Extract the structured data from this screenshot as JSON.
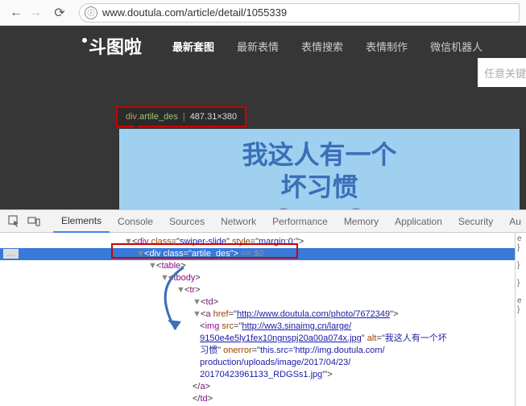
{
  "browser": {
    "url": "www.doutula.com/article/detail/1055339",
    "info_icon": "ⓘ"
  },
  "nav": {
    "logo": "斗图啦",
    "items": [
      "最新套图",
      "最新表情",
      "表情搜索",
      "表情制作",
      "微信机器人"
    ],
    "active_index": 0,
    "search_placeholder": "任意关键"
  },
  "tooltip": {
    "tag": "div",
    "cls": ".artile_des",
    "dim": "487.31×380"
  },
  "meme": {
    "line1": "我这人有一个",
    "line2": "坏习惯"
  },
  "devtools": {
    "tabs": [
      "Elements",
      "Console",
      "Sources",
      "Network",
      "Performance",
      "Memory",
      "Application",
      "Security",
      "Au"
    ],
    "active_index": 0,
    "breadcrumb_dots": "…",
    "code": {
      "l0_pre": "<div class=\"swiper-slide\" style=\"margin:0;\">",
      "l1": {
        "tag": "div",
        "attr": "class",
        "val": "artile_des",
        "suffix": " == $0"
      },
      "l2": "<table>",
      "l3": "<tbody>",
      "l4": "<tr>",
      "l5": "<td>",
      "l6_pre": "<a ",
      "l6_attr": "href",
      "l6_val": "http://www.doutula.com/photo/7672349",
      "l6_post": ">",
      "l7_pre": "<img ",
      "l7_a1": "src",
      "l7_v1": "http://ww3.sinaimg.cn/large/",
      "l7_v1b": "9150e4e5ly1fex10ngnspj20a00a074x.jpg",
      "l7_a2": "alt",
      "l7_v2": "我这人有一个坏",
      "l7_v2b": "习惯",
      "l7_a3": "onerror",
      "l7_v3": "this.src='http://img.doutula.com/",
      "l7_v3b": "production/uploads/image/2017/04/23/",
      "l7_v3c": "20170423961133_RDGSs1.jpg'",
      "l7_post": ">",
      "l8": "</a>",
      "l9": "</td>"
    },
    "side": [
      "e",
      "}",
      "",
      "}",
      "",
      "}",
      "",
      "e",
      "}"
    ]
  }
}
